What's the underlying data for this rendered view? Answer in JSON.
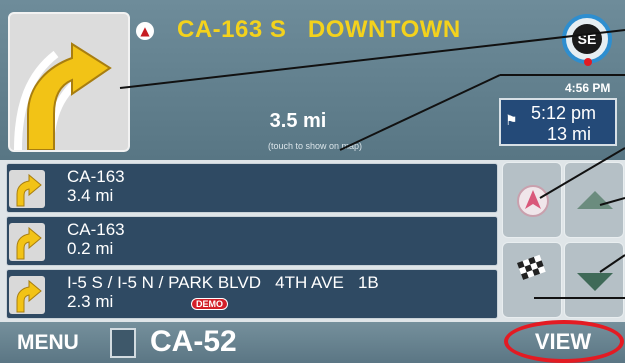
{
  "header": {
    "street": "CA-163 S   DOWNTOWN",
    "north_icon": "north-arrow-icon",
    "compass": "SE",
    "clock": "4:56 PM"
  },
  "maneuver": {
    "icon": "turn-right-arrow-icon",
    "distance": "3.5 mi",
    "hint": "(touch to show on map)"
  },
  "eta": {
    "flag_icon": "checkered-flag-icon",
    "time": "5:12 pm",
    "distance": "13 mi"
  },
  "turn_list": [
    {
      "icon": "turn-right-icon",
      "name": "CA-163",
      "distance": "3.4 mi"
    },
    {
      "icon": "turn-right-icon",
      "name": "CA-163",
      "distance": "0.2 mi"
    },
    {
      "icon": "turn-right-icon",
      "name": "I-5 S / I-5 N / PARK BLVD   4TH AVE   1B",
      "distance": "2.3 mi",
      "badge": "DEMO"
    }
  ],
  "controls": {
    "north_icon": "north-arrow-icon",
    "up_icon": "scroll-up-icon",
    "flag_icon": "checkered-flag-icon",
    "down_icon": "scroll-down-icon"
  },
  "bottom": {
    "menu": "MENU",
    "sign_icon": "road-sign-icon",
    "road": "CA-52",
    "view": "VIEW"
  },
  "colors": {
    "title_yellow": "#f4d21c",
    "row_bg": "#2f4a63",
    "eta_bg": "#244a78",
    "annotation_red": "#e31b23"
  }
}
